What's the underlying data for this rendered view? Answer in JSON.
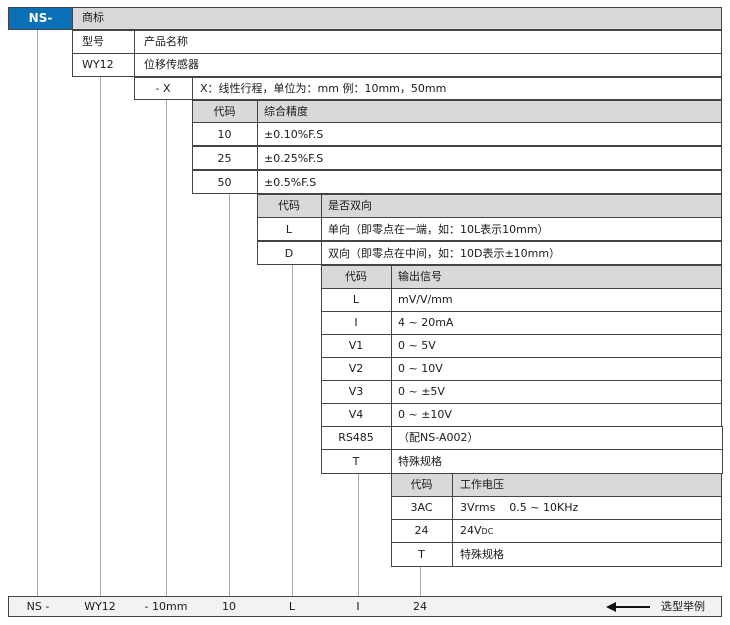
{
  "top": {
    "prefix": "NS-",
    "brand_label": "商标",
    "model_label": "型号",
    "product_name_label": "产品名称",
    "model_code": "WY12",
    "product_name": "位移传感器",
    "x_code": "- X",
    "x_desc": "X：线性行程，单位为：mm 例：10mm，50mm"
  },
  "accuracy": {
    "header_code": "代码",
    "header_desc": "综合精度",
    "rows": [
      {
        "code": "10",
        "desc": "±0.10%F.S"
      },
      {
        "code": "25",
        "desc": "±0.25%F.S"
      },
      {
        "code": "50",
        "desc": "±0.5%F.S"
      }
    ]
  },
  "direction": {
    "header_code": "代码",
    "header_desc": "是否双向",
    "rows": [
      {
        "code": "L",
        "desc": "单向（即零点在一端，如：10L表示10mm）"
      },
      {
        "code": "D",
        "desc": "双向（即零点在中间，如：10D表示±10mm）"
      }
    ]
  },
  "signal": {
    "header_code": "代码",
    "header_desc": "输出信号",
    "rows": [
      {
        "code": "L",
        "desc": "mV/V/mm"
      },
      {
        "code": "I",
        "desc": "4 ~ 20mA"
      },
      {
        "code": "V1",
        "desc": "0 ~ 5V"
      },
      {
        "code": "V2",
        "desc": "0 ~ 10V"
      },
      {
        "code": "V3",
        "desc": "0 ~ ±5V"
      },
      {
        "code": "V4",
        "desc": "0 ~ ±10V"
      },
      {
        "code": "RS485",
        "desc": "（配NS-A002）"
      },
      {
        "code": "T",
        "desc": "特殊规格"
      }
    ]
  },
  "voltage": {
    "header_code": "代码",
    "header_desc": "工作电压",
    "rows": [
      {
        "code": "3AC",
        "desc": "3Vrms    0.5 ~ 10KHz"
      },
      {
        "code": "24",
        "desc": "24V",
        "sub": "DC"
      },
      {
        "code": "T",
        "desc": "特殊规格"
      }
    ]
  },
  "example": {
    "parts": [
      "NS -",
      "WY12",
      "- 10mm",
      "10",
      "L",
      "I",
      "24"
    ],
    "arrow_label": "选型举例"
  }
}
